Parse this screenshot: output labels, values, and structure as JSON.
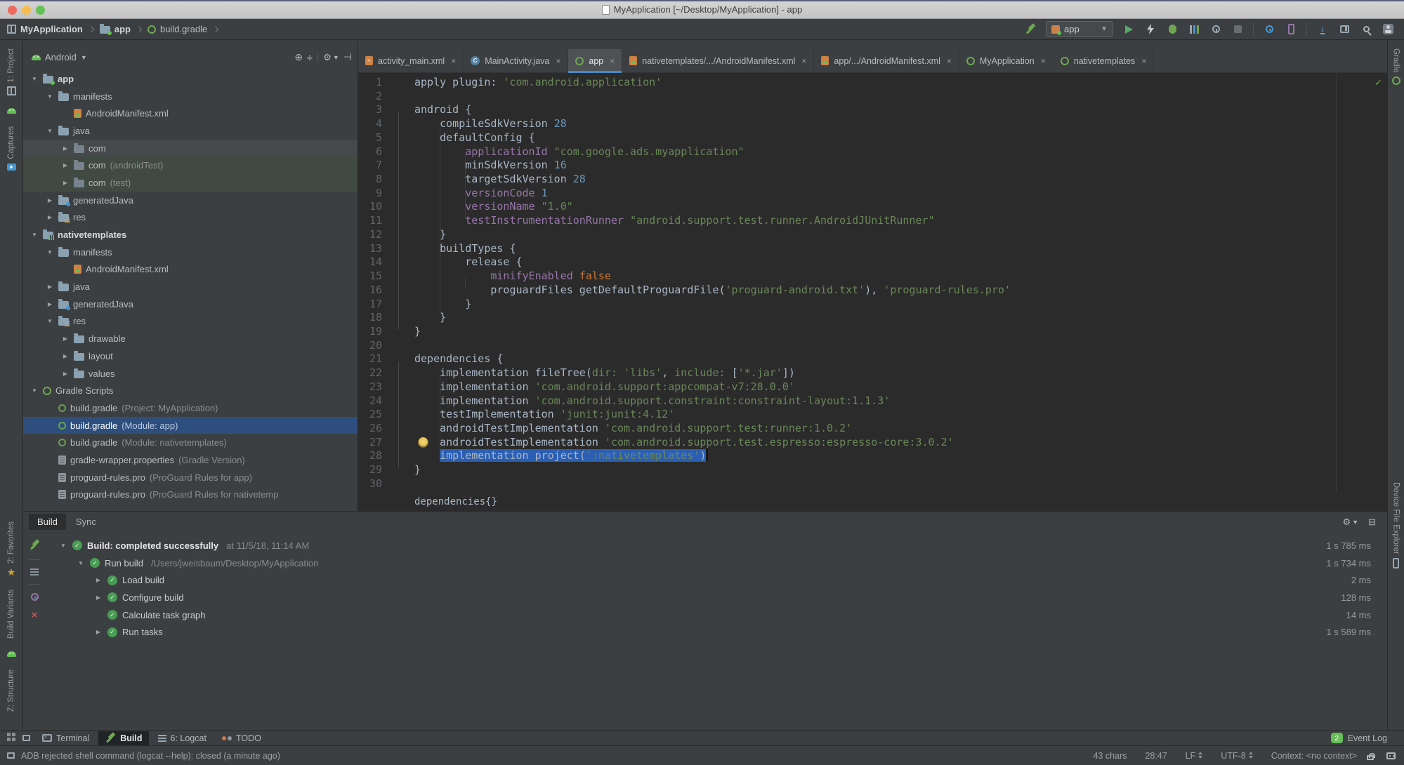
{
  "window": {
    "title": "MyApplication [~/Desktop/MyApplication] - app"
  },
  "navbar": {
    "breadcrumbs": [
      {
        "label": "MyApplication",
        "icon": "project-tool",
        "bold": true
      },
      {
        "label": "app",
        "icon": "folder-app",
        "bold": true
      },
      {
        "label": "build.gradle",
        "icon": "gradle",
        "bold": false
      }
    ],
    "run_config": "app"
  },
  "left_stripe": {
    "top": [
      {
        "label": "1: Project",
        "icon": "project-tool"
      },
      {
        "label": "",
        "icon": "android-head"
      },
      {
        "label": "Captures",
        "icon": "captures"
      }
    ],
    "bottom": [
      {
        "label": "2: Favorites",
        "icon": "star"
      },
      {
        "label": "Build Variants",
        "icon": ""
      },
      {
        "label": "",
        "icon": "android-head"
      },
      {
        "label": "Z: Structure",
        "icon": ""
      }
    ]
  },
  "right_stripe": {
    "top": [
      {
        "label": "Gradle",
        "icon": "gradle"
      }
    ],
    "bottom": [
      {
        "label": "Device File Explorer",
        "icon": "phone"
      }
    ]
  },
  "project_panel": {
    "view_selector": "Android",
    "tree": [
      {
        "level": 0,
        "arrow": "down",
        "icon": "folder-app",
        "label": "app",
        "bold": true
      },
      {
        "level": 1,
        "arrow": "down",
        "icon": "folder",
        "label": "manifests"
      },
      {
        "level": 2,
        "arrow": "none",
        "icon": "manifest",
        "label": "AndroidManifest.xml"
      },
      {
        "level": 1,
        "arrow": "down",
        "icon": "folder",
        "label": "java"
      },
      {
        "level": 2,
        "arrow": "right",
        "icon": "package",
        "label": "com",
        "rowbg": "hover"
      },
      {
        "level": 2,
        "arrow": "right",
        "icon": "package",
        "label": "com",
        "secondary": "(androidTest)",
        "rowbg": "test"
      },
      {
        "level": 2,
        "arrow": "right",
        "icon": "package",
        "label": "com",
        "secondary": "(test)",
        "rowbg": "test"
      },
      {
        "level": 1,
        "arrow": "right",
        "icon": "folder-gen",
        "label": "generatedJava"
      },
      {
        "level": 1,
        "arrow": "right",
        "icon": "folder-res",
        "label": "res"
      },
      {
        "level": 0,
        "arrow": "down",
        "icon": "module",
        "label": "nativetemplates",
        "bold": true
      },
      {
        "level": 1,
        "arrow": "down",
        "icon": "folder",
        "label": "manifests"
      },
      {
        "level": 2,
        "arrow": "none",
        "icon": "manifest",
        "label": "AndroidManifest.xml"
      },
      {
        "level": 1,
        "arrow": "right",
        "icon": "folder",
        "label": "java"
      },
      {
        "level": 1,
        "arrow": "right",
        "icon": "folder-gen",
        "label": "generatedJava"
      },
      {
        "level": 1,
        "arrow": "down",
        "icon": "folder-res",
        "label": "res"
      },
      {
        "level": 2,
        "arrow": "right",
        "icon": "folder",
        "label": "drawable"
      },
      {
        "level": 2,
        "arrow": "right",
        "icon": "folder",
        "label": "layout"
      },
      {
        "level": 2,
        "arrow": "right",
        "icon": "folder",
        "label": "values"
      },
      {
        "level": 0,
        "arrow": "down",
        "icon": "gradle",
        "label": "Gradle Scripts"
      },
      {
        "level": 1,
        "arrow": "none",
        "icon": "gradle-file",
        "label": "build.gradle",
        "secondary": "(Project: MyApplication)"
      },
      {
        "level": 1,
        "arrow": "none",
        "icon": "gradle-file",
        "label": "build.gradle",
        "secondary": "(Module: app)",
        "selected": true
      },
      {
        "level": 1,
        "arrow": "none",
        "icon": "gradle-file",
        "label": "build.gradle",
        "secondary": "(Module: nativetemplates)"
      },
      {
        "level": 1,
        "arrow": "none",
        "icon": "props",
        "label": "gradle-wrapper.properties",
        "secondary": "(Gradle Version)"
      },
      {
        "level": 1,
        "arrow": "none",
        "icon": "pro",
        "label": "proguard-rules.pro",
        "secondary": "(ProGuard Rules for app)"
      },
      {
        "level": 1,
        "arrow": "none",
        "icon": "pro",
        "label": "proguard-rules.pro",
        "secondary": "(ProGuard Rules for nativetemp"
      }
    ]
  },
  "editor_tabs": [
    {
      "label": "activity_main.xml",
      "icon": "xml"
    },
    {
      "label": "MainActivity.java",
      "icon": "class"
    },
    {
      "label": "app",
      "icon": "gradle",
      "selected": true
    },
    {
      "label": "nativetemplates/.../AndroidManifest.xml",
      "icon": "manifest"
    },
    {
      "label": "app/.../AndroidManifest.xml",
      "icon": "manifest"
    },
    {
      "label": "MyApplication",
      "icon": "gradle"
    },
    {
      "label": "nativetemplates",
      "icon": "gradle"
    }
  ],
  "editor": {
    "context_bar": "dependencies{}",
    "bulb_line": 27,
    "caret_line": 28,
    "lines": [
      [
        {
          "t": "apply plugin: ",
          "c": "d"
        },
        {
          "t": "'com.android.application'",
          "c": "s"
        }
      ],
      [],
      [
        {
          "t": "android {",
          "c": "d"
        }
      ],
      [
        {
          "t": "    compileSdkVersion ",
          "c": "d"
        },
        {
          "t": "28",
          "c": "n"
        }
      ],
      [
        {
          "t": "    defaultConfig {",
          "c": "d"
        }
      ],
      [
        {
          "t": "        ",
          "c": "d"
        },
        {
          "t": "applicationId ",
          "c": "p"
        },
        {
          "t": "\"com.google.ads.myapplication\"",
          "c": "s"
        }
      ],
      [
        {
          "t": "        minSdkVersion ",
          "c": "d"
        },
        {
          "t": "16",
          "c": "n"
        }
      ],
      [
        {
          "t": "        targetSdkVersion ",
          "c": "d"
        },
        {
          "t": "28",
          "c": "n"
        }
      ],
      [
        {
          "t": "        ",
          "c": "d"
        },
        {
          "t": "versionCode ",
          "c": "p"
        },
        {
          "t": "1",
          "c": "n"
        }
      ],
      [
        {
          "t": "        ",
          "c": "d"
        },
        {
          "t": "versionName ",
          "c": "p"
        },
        {
          "t": "\"1.0\"",
          "c": "s"
        }
      ],
      [
        {
          "t": "        ",
          "c": "d"
        },
        {
          "t": "testInstrumentationRunner ",
          "c": "p"
        },
        {
          "t": "\"android.support.test.runner.AndroidJUnitRunner\"",
          "c": "s"
        }
      ],
      [
        {
          "t": "    }",
          "c": "d"
        }
      ],
      [
        {
          "t": "    buildTypes {",
          "c": "d"
        }
      ],
      [
        {
          "t": "        release {",
          "c": "d"
        }
      ],
      [
        {
          "t": "            ",
          "c": "d"
        },
        {
          "t": "minifyEnabled ",
          "c": "p"
        },
        {
          "t": "false",
          "c": "k"
        }
      ],
      [
        {
          "t": "            proguardFiles getDefaultProguardFile(",
          "c": "d"
        },
        {
          "t": "'proguard-android.txt'",
          "c": "s"
        },
        {
          "t": "), ",
          "c": "d"
        },
        {
          "t": "'proguard-rules.pro'",
          "c": "s"
        }
      ],
      [
        {
          "t": "        }",
          "c": "d"
        }
      ],
      [
        {
          "t": "    }",
          "c": "d"
        }
      ],
      [
        {
          "t": "}",
          "c": "d"
        }
      ],
      [],
      [
        {
          "t": "dependencies {",
          "c": "d"
        }
      ],
      [
        {
          "t": "    implementation fileTree(",
          "c": "d"
        },
        {
          "t": "dir: ",
          "c": "m"
        },
        {
          "t": "'libs'",
          "c": "s"
        },
        {
          "t": ", ",
          "c": "d"
        },
        {
          "t": "include: ",
          "c": "m"
        },
        {
          "t": "[",
          "c": "d"
        },
        {
          "t": "'*.jar'",
          "c": "s"
        },
        {
          "t": "])",
          "c": "d"
        }
      ],
      [
        {
          "t": "    implementation ",
          "c": "d"
        },
        {
          "t": "'com.android.support:appcompat-v7:28.0.0'",
          "c": "s"
        }
      ],
      [
        {
          "t": "    implementation ",
          "c": "d"
        },
        {
          "t": "'com.android.support.constraint:constraint-layout:1.1.3'",
          "c": "s"
        }
      ],
      [
        {
          "t": "    testImplementation ",
          "c": "d"
        },
        {
          "t": "'junit:junit:4.12'",
          "c": "s"
        }
      ],
      [
        {
          "t": "    androidTestImplementation ",
          "c": "d"
        },
        {
          "t": "'com.android.support.test:runner:1.0.2'",
          "c": "s"
        }
      ],
      [
        {
          "t": "    androidTestImplementation ",
          "c": "d"
        },
        {
          "t": "'com.android.support.test.espresso:espresso-core:3.0.2'",
          "c": "s"
        }
      ],
      [
        {
          "t": "    ",
          "c": "d"
        },
        {
          "t": "implementation project(",
          "c": "d",
          "sel": 1
        },
        {
          "t": "':nativetemplates'",
          "c": "s",
          "sel": 1
        },
        {
          "t": ")",
          "c": "d",
          "sel": 1
        }
      ],
      [
        {
          "t": "}",
          "c": "d"
        }
      ],
      []
    ]
  },
  "build_panel": {
    "tabs": [
      {
        "label": "Build",
        "selected": true
      },
      {
        "label": "Sync"
      }
    ],
    "rows": [
      {
        "level": 0,
        "arrow": "down",
        "label": "Build: completed successfully",
        "secondary": "at 11/5/18, 11:14 AM",
        "time": "1 s 785 ms",
        "bold": true
      },
      {
        "level": 1,
        "arrow": "down",
        "label": "Run build",
        "secondary": "/Users/jweisbaum/Desktop/MyApplication",
        "time": "1 s 734 ms"
      },
      {
        "level": 2,
        "arrow": "right",
        "label": "Load build",
        "time": "2 ms"
      },
      {
        "level": 2,
        "arrow": "right",
        "label": "Configure build",
        "time": "128 ms"
      },
      {
        "level": 2,
        "arrow": "none",
        "label": "Calculate task graph",
        "time": "14 ms"
      },
      {
        "level": 2,
        "arrow": "right",
        "label": "Run tasks",
        "time": "1 s 589 ms"
      }
    ]
  },
  "bottom_bar": {
    "tabs": [
      {
        "label": "Terminal",
        "icon": "terminal"
      },
      {
        "label": "Build",
        "icon": "hammer",
        "selected": true
      },
      {
        "label": "6: Logcat",
        "icon": "list"
      },
      {
        "label": "TODO",
        "icon": "todo"
      }
    ],
    "event_log": {
      "label": "Event Log",
      "count": "2"
    }
  },
  "status_bar": {
    "message": "ADB rejected shell command (logcat --help): closed (a minute ago)",
    "right": [
      {
        "label": "43 chars"
      },
      {
        "label": "28:47"
      },
      {
        "label": "LF",
        "arrows": true
      },
      {
        "label": "UTF-8",
        "arrows": true
      },
      {
        "label": "Context: <no context>"
      }
    ]
  }
}
